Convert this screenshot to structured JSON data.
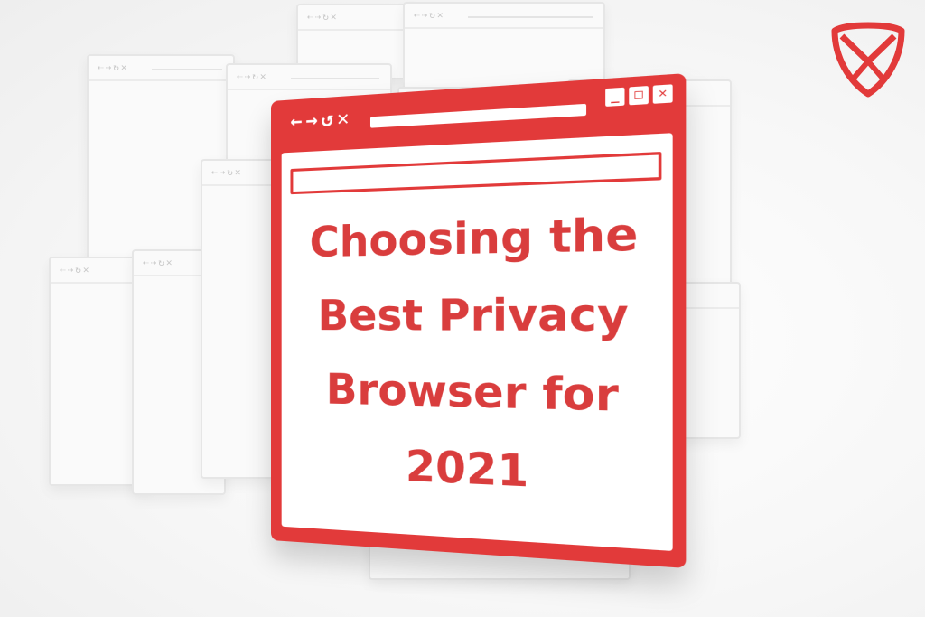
{
  "headline": {
    "line1": "Choosing the",
    "line2": "Best Privacy",
    "line3": "Browser for",
    "line4": "2021"
  },
  "browser_window": {
    "nav_icons": [
      "arrow-left-icon",
      "arrow-right-icon",
      "reload-icon",
      "close-x-icon"
    ],
    "window_controls": [
      "minimize-icon",
      "maximize-icon",
      "close-icon"
    ]
  },
  "colors": {
    "accent": "#e23a3a",
    "headline": "#d93d3d",
    "ghost_border": "#e6e6e6",
    "background": "#f5f5f5"
  },
  "logo": {
    "icon": "brand-shield-envelope-logo"
  }
}
